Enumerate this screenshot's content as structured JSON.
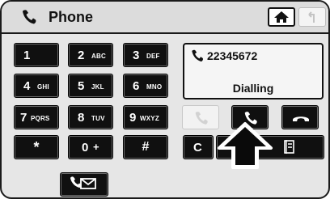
{
  "header": {
    "title": "Phone",
    "title_icon": "handset-icon",
    "home_icon": "home-icon",
    "back_icon": "back-arrow-icon"
  },
  "keypad": {
    "keys": [
      {
        "label": "1",
        "letters": ""
      },
      {
        "label": "2",
        "letters": "ABC"
      },
      {
        "label": "3",
        "letters": "DEF"
      },
      {
        "label": "4",
        "letters": "GHI"
      },
      {
        "label": "5",
        "letters": "JKL"
      },
      {
        "label": "6",
        "letters": "MNO"
      },
      {
        "label": "7",
        "letters": "PQRS"
      },
      {
        "label": "8",
        "letters": "TUV"
      },
      {
        "label": "9",
        "letters": "WXYZ"
      },
      {
        "label": "*",
        "letters": ""
      },
      {
        "label": "0",
        "letters": "+"
      },
      {
        "label": "#",
        "letters": ""
      }
    ],
    "clear_label": "C"
  },
  "display": {
    "number": "22345672",
    "status": "Dialling"
  },
  "call_controls": {
    "disabled_icon": "handset-icon",
    "call_icon": "call-icon",
    "end_icon": "end-call-icon"
  },
  "colors": {
    "key_bg": "#101010",
    "panel_bg": "#e6e6e6",
    "display_bg": "#f5f5f5"
  }
}
